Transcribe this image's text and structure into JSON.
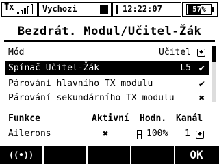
{
  "status": {
    "tx_label": "Tx",
    "signal_bars": 1,
    "model_name": "Vychozi",
    "time": "12:22:07",
    "battery_percent_label": "57%",
    "battery_level": 0.57
  },
  "page": {
    "title": "Bezdrát. Modul/Učitel-Žák"
  },
  "settings": {
    "mode": {
      "label": "Mód",
      "value": "Učitel"
    },
    "switch": {
      "label": "Spínač Učitel-Žák",
      "value": "L5",
      "mark": "✔"
    },
    "pair_main": {
      "label": "Párování hlavního TX modulu",
      "mark": "✔"
    },
    "pair_secondary": {
      "label": "Párování sekundárního TX modulu",
      "mark": "✖"
    }
  },
  "table": {
    "headers": {
      "function": "Funkce",
      "active": "Aktivní",
      "value": "Hodn.",
      "channel": "Kanál"
    },
    "rows": [
      {
        "function": "Ailerons",
        "active": "✖",
        "value": "100%",
        "channel": "1"
      }
    ]
  },
  "softkeys": {
    "f1": "((•))",
    "f5": "OK"
  },
  "icons": {
    "signal": "signal-bars-icon",
    "clock": "clock-icon",
    "battery": "battery-icon",
    "dropdown": "dropdown-arrow-icon",
    "check": "check-icon",
    "cross": "cross-icon",
    "wireless": "wireless-icon"
  }
}
